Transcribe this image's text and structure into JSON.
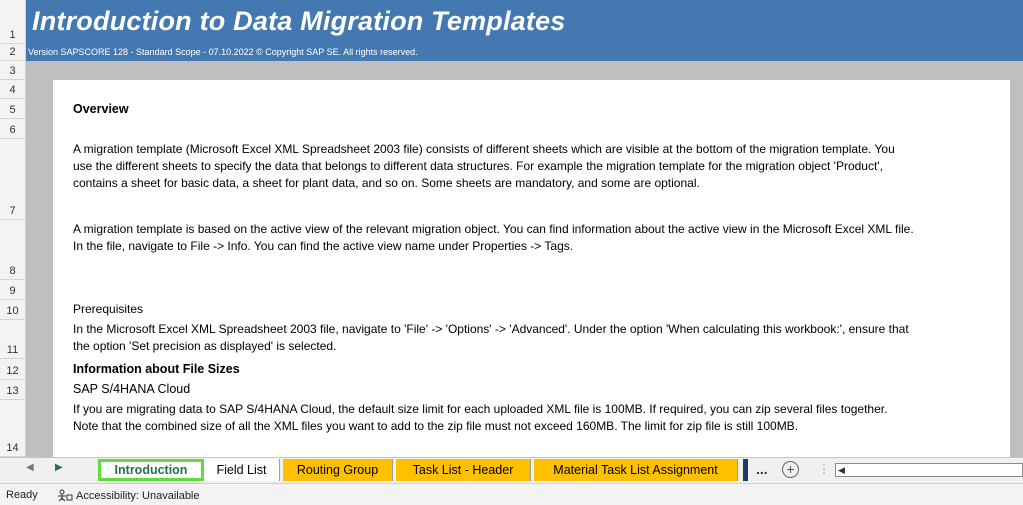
{
  "header": {
    "title": "Introduction to Data Migration Templates",
    "version": "Version SAPSCORE 128  - Standard Scope - 07.10.2022 © Copyright SAP SE. All rights reserved."
  },
  "rows": [
    "1",
    "2",
    "3",
    "4",
    "5",
    "6",
    "7",
    "8",
    "9",
    "10",
    "11",
    "12",
    "13",
    "14"
  ],
  "content": {
    "overview_heading": "Overview",
    "para1_line1": "A migration template (Microsoft Excel XML Spreadsheet 2003 file) consists of different sheets which are visible at the bottom of the migration template. You",
    "para1_line2": "use the different sheets to specify the data that belongs to different data structures. For example the migration template for the migration object 'Product',",
    "para1_line3": "contains a sheet for basic data, a sheet for plant data, and so on. Some sheets are mandatory, and some are optional.",
    "para2_line1": "A migration template is based on the active view of the relevant migration object. You can find information about the active view in the Microsoft Excel XML file.",
    "para2_line2": "In the file, navigate to File -> Info. You can find the active view name under Properties -> Tags.",
    "prereq_heading": "Prerequisites",
    "prereq_line1": "In the Microsoft Excel XML Spreadsheet 2003 file, navigate to 'File' -> 'Options' -> 'Advanced'. Under the option 'When calculating this workbook:', ensure that",
    "prereq_line2": "the option 'Set precision as displayed' is selected.",
    "filesize_heading": "Information about File Sizes",
    "cloud_heading": "SAP S/4HANA Cloud",
    "filesize_line1": "If you are migrating data to SAP S/4HANA Cloud, the default size limit for each uploaded XML file is 100MB.  If required, you can zip several files together.",
    "filesize_line2": "Note that the combined size of all the XML files you want to add to the zip file must not exceed 160MB.  The limit for zip file is still 100MB."
  },
  "tabs": {
    "intro": "Introduction",
    "field_list": "Field List",
    "routing_group": "Routing Group",
    "task_list_header": "Task List - Header",
    "material_task": "Material Task List Assignment",
    "more": "...",
    "add": "+"
  },
  "status": {
    "ready": "Ready",
    "accessibility": "Accessibility: Unavailable"
  },
  "colors": {
    "title_band": "#4379b0",
    "tab_yellow": "#ffc000",
    "active_tab_border": "#5fdc3c"
  }
}
